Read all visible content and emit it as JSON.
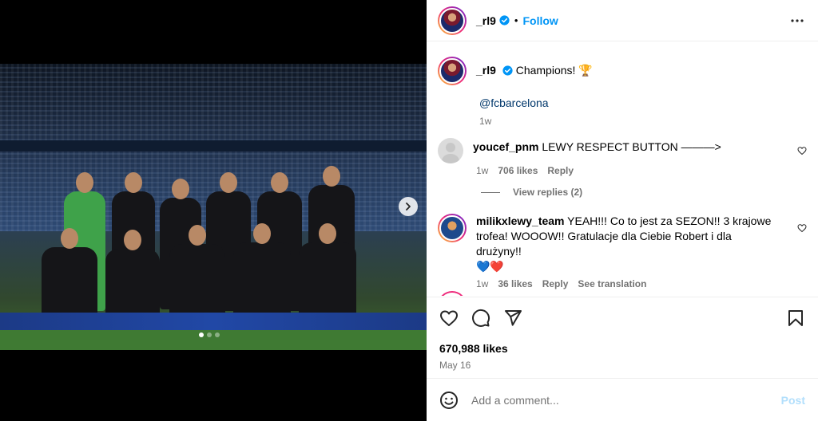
{
  "post": {
    "author": "_rl9",
    "follow_label": "Follow",
    "separator": "•",
    "caption": "Champions! 🏆",
    "mention": "@fcbarcelona",
    "caption_time": "1w",
    "likes": "670,988 likes",
    "date": "May 16"
  },
  "comments": [
    {
      "user": "youcef_pnm",
      "text": "LEWY RESPECT BUTTON ———>",
      "time": "1w",
      "likes": "706 likes",
      "reply_label": "Reply",
      "view_replies": "View replies (2)"
    },
    {
      "user": "milikxlewy_team",
      "text": "YEAH!!! Co to jest za SEZON!! 3 krajowe trofea! WOOOW!! Gratulacje dla Ciebie Robert i dla drużyny!!",
      "emoji_line": "💙❤️",
      "time": "1w",
      "likes": "36 likes",
      "reply_label": "Reply",
      "translate_label": "See translation"
    }
  ],
  "composer": {
    "placeholder": "Add a comment...",
    "post_label": "Post"
  },
  "colors": {
    "link": "#0095f6",
    "mention": "#00376b",
    "muted": "#737373",
    "post_disabled": "#b2dffc"
  },
  "icons": {
    "verified": "verified-badge-icon",
    "more": "more-options-icon",
    "like": "heart-icon",
    "comment": "comment-icon",
    "share": "share-icon",
    "save": "bookmark-icon",
    "emoji": "emoji-icon",
    "next": "chevron-right-icon"
  },
  "carousel": {
    "slides": 3,
    "current": 1
  }
}
